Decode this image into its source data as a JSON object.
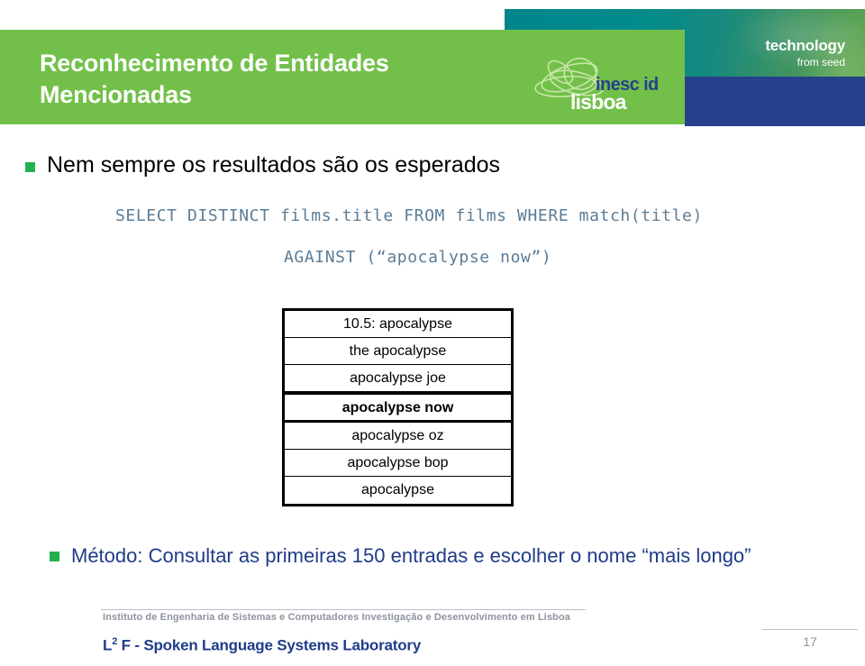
{
  "header": {
    "title": "Reconhecimento de Entidades Mencionadas",
    "logo": {
      "primary": "inesc id",
      "secondary": "lisboa"
    },
    "tagline_line1": "technology",
    "tagline_line2": "from seed",
    "colors": {
      "green": "#72c04a",
      "teal": "#00868c",
      "navy": "#27408b"
    }
  },
  "body": {
    "bullet_1": "Nem sempre os resultados são os esperados",
    "sql_line_1": "SELECT DISTINCT films.title FROM films WHERE match(title)",
    "sql_line_2": "AGAINST (“apocalypse now”)",
    "results": [
      {
        "text": "10.5: apocalypse",
        "highlighted": false
      },
      {
        "text": "the apocalypse",
        "highlighted": false
      },
      {
        "text": "apocalypse joe",
        "highlighted": false
      },
      {
        "text": "apocalypse now",
        "highlighted": true
      },
      {
        "text": "apocalypse oz",
        "highlighted": false
      },
      {
        "text": "apocalypse bop",
        "highlighted": false
      },
      {
        "text": "apocalypse",
        "highlighted": false
      }
    ],
    "bullet_2": "Método: Consultar as primeiras 150 entradas e escolher o nome “mais longo”"
  },
  "footer": {
    "institute": "Instituto de Engenharia de Sistemas e Computadores Investigação e Desenvolvimento em Lisboa",
    "lab_prefix": "L",
    "lab_sup": "2",
    "lab_rest": " F - Spoken Language Systems Laboratory",
    "page_number": "17"
  }
}
